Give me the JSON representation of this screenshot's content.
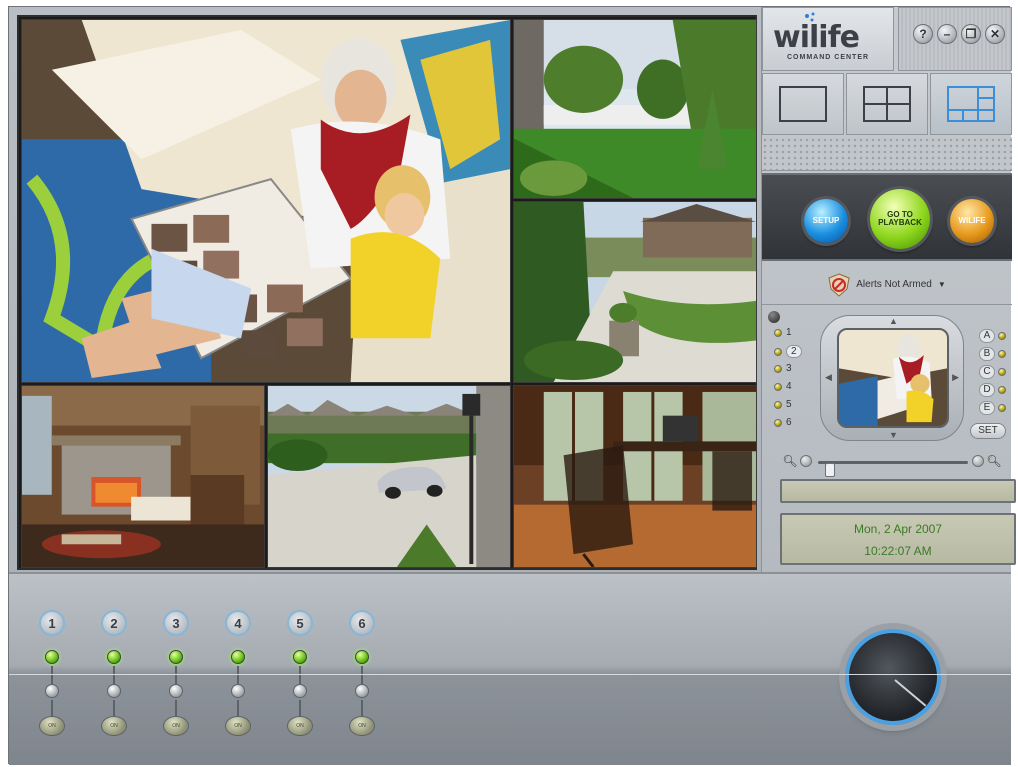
{
  "app": {
    "logo": {
      "name": "wilife",
      "subtitle": "COMMAND CENTER"
    },
    "window_controls": [
      {
        "id": "help",
        "icon": "help-icon",
        "label": "?"
      },
      {
        "id": "minimize",
        "icon": "minimize-icon",
        "label": "–"
      },
      {
        "id": "restore",
        "icon": "restore-icon",
        "label": "❐"
      },
      {
        "id": "close",
        "icon": "close-icon",
        "label": "✕"
      }
    ],
    "layouts": [
      {
        "id": "single",
        "icon": "single-view-icon",
        "active": false
      },
      {
        "id": "quad",
        "icon": "quad-view-icon",
        "active": false
      },
      {
        "id": "six",
        "icon": "six-view-icon",
        "active": true
      }
    ],
    "actions": {
      "setup_label": "SETUP",
      "playback_label": "GO TO PLAYBACK",
      "wilife_label": "WILIFE"
    },
    "alerts": {
      "label": "Alerts Not Armed",
      "icon": "alerts-shield-icon"
    },
    "camera_select": {
      "cameras": [
        "1",
        "2",
        "3",
        "4",
        "5",
        "6"
      ],
      "selected": "2",
      "presets": [
        "A",
        "B",
        "C",
        "D",
        "E"
      ],
      "set_label": "SET"
    },
    "zoom": {
      "level": 0.05
    },
    "status": {
      "line1": "",
      "date": "Mon, 2 Apr 2007",
      "time": "10:22:07 AM"
    },
    "channels": [
      {
        "number": "1",
        "led": "green",
        "button_label": "ON"
      },
      {
        "number": "2",
        "led": "green",
        "button_label": "ON"
      },
      {
        "number": "3",
        "led": "green",
        "button_label": "ON"
      },
      {
        "number": "4",
        "led": "green",
        "button_label": "ON"
      },
      {
        "number": "5",
        "led": "green",
        "button_label": "ON"
      },
      {
        "number": "6",
        "led": "green",
        "button_label": "ON"
      }
    ],
    "colors": {
      "accent_blue": "#4aa0e0",
      "led_green": "#6cc51b",
      "lcd_text": "#3a7a25",
      "setup_orb": "#1a8fe0",
      "playback_orb": "#8ed61c",
      "wilife_orb": "#e79a1d"
    }
  }
}
